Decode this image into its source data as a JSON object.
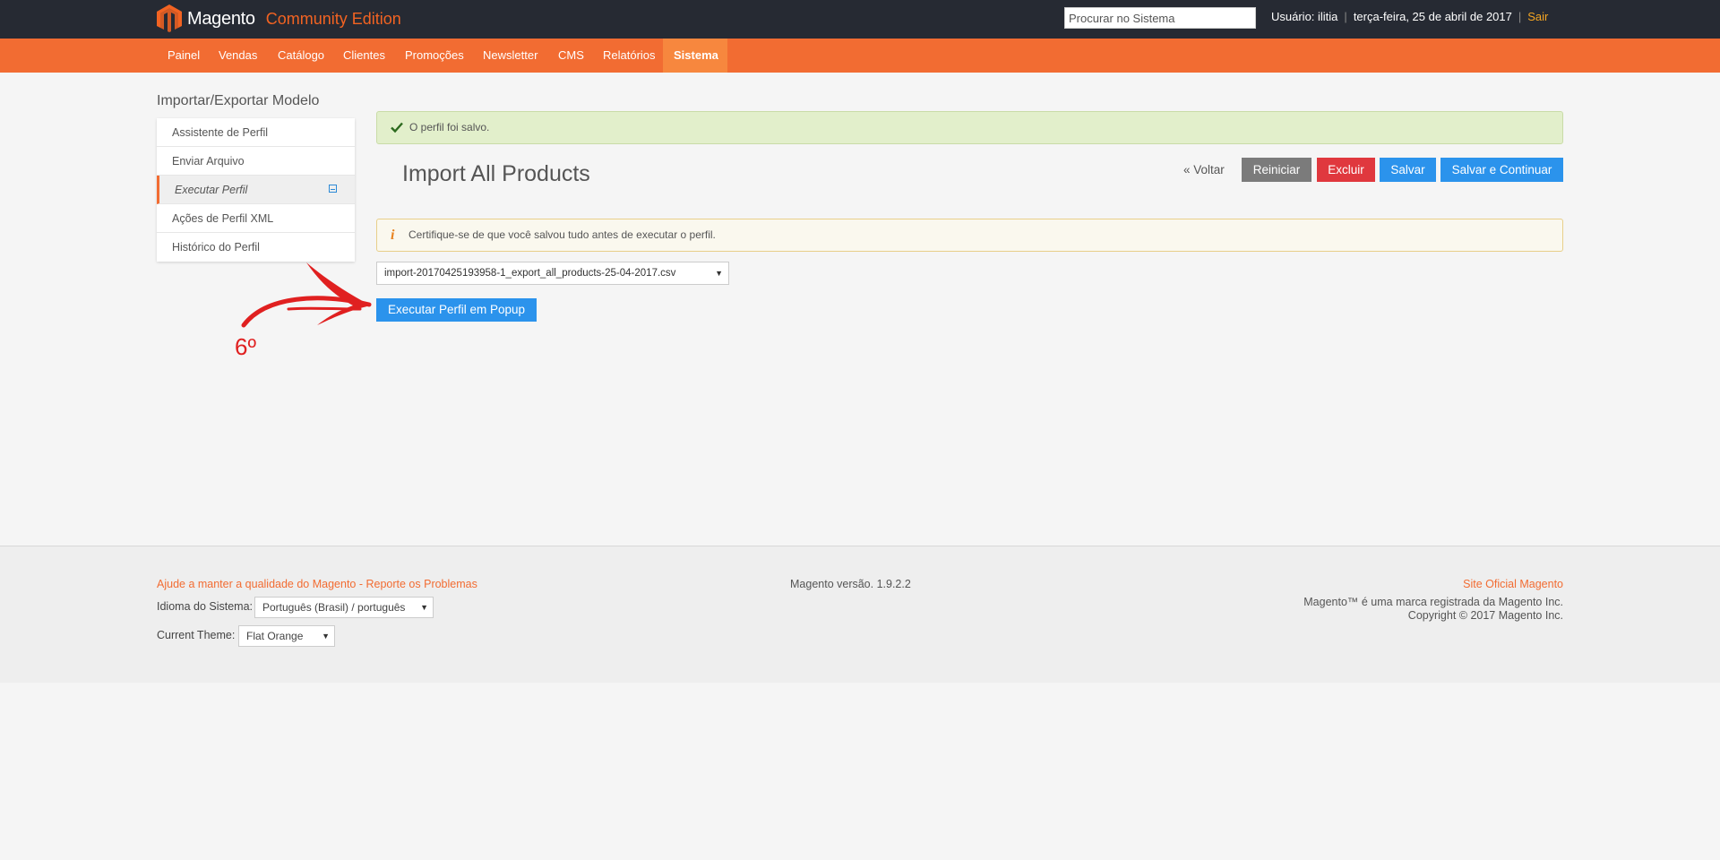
{
  "header": {
    "brand": "Magento",
    "edition": "Community Edition",
    "search_placeholder": "Procurar no Sistema",
    "user_label": "Usuário: ilitia",
    "date": "terça-feira, 25 de abril de 2017",
    "logout": "Sair"
  },
  "nav": {
    "items": [
      "Painel",
      "Vendas",
      "Catálogo",
      "Clientes",
      "Promoções",
      "Newsletter",
      "CMS",
      "Relatórios",
      "Sistema"
    ],
    "active": "Sistema"
  },
  "sidebar": {
    "title": "Importar/Exportar Modelo",
    "tabs": [
      "Assistente de Perfil",
      "Enviar Arquivo",
      "Executar Perfil",
      "Ações de Perfil XML",
      "Histórico do Perfil"
    ],
    "active_tab": "Executar Perfil"
  },
  "messages": {
    "success": "O perfil foi salvo.",
    "notice": "Certifique-se de que você salvou tudo antes de executar o perfil."
  },
  "page": {
    "title": "Import All Products",
    "back": "« Voltar",
    "reset": "Reiniciar",
    "delete": "Excluir",
    "save": "Salvar",
    "save_continue": "Salvar e Continuar",
    "file_selected": "import-20170425193958-1_export_all_products-25-04-2017.csv",
    "run_popup": "Executar Perfil em Popup"
  },
  "annotation": {
    "label": "6º",
    "color": "#e02020"
  },
  "footer": {
    "help": "Ajude a manter a qualidade do Magento - Reporte os Problemas",
    "lang_label": "Idioma do Sistema:",
    "lang_value": "Português (Brasil) / português",
    "theme_label": "Current Theme:",
    "theme_value": "Flat Orange",
    "version": "Magento versão. 1.9.2.2",
    "site": "Site Oficial Magento",
    "trademark": "Magento™ é uma marca registrada da Magento Inc.",
    "copyright": "Copyright © 2017 Magento Inc."
  },
  "colors": {
    "topbar": "#262a33",
    "navbar": "#f26c32",
    "accent_blue": "#2b93ec",
    "danger": "#e0383e"
  }
}
